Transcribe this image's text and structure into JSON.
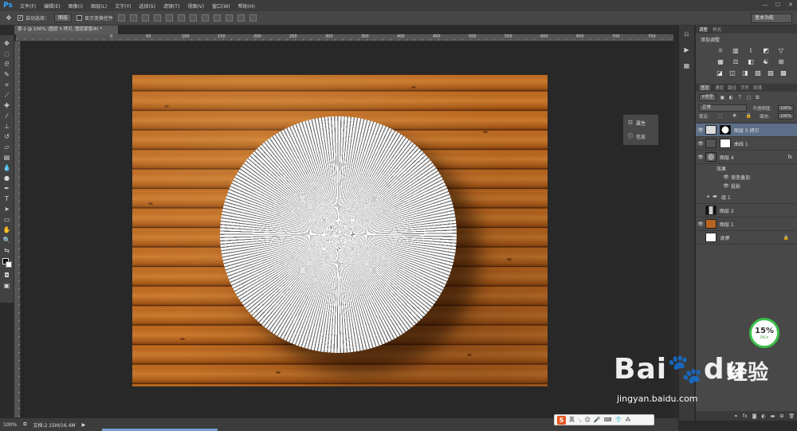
{
  "app": {
    "logo": "Ps",
    "menus": [
      "文件(F)",
      "编辑(E)",
      "图像(I)",
      "图层(L)",
      "文字(Y)",
      "选择(S)",
      "滤镜(T)",
      "视图(V)",
      "窗口(W)",
      "帮助(H)"
    ],
    "window_buttons": [
      "—",
      "☐",
      "✕"
    ]
  },
  "options": {
    "auto_select_label": "自动选择：",
    "auto_select_target": "图层",
    "show_transform_label": "显示变换控件",
    "workspace": "基本功能"
  },
  "document": {
    "tab_title": "景-1 @ 100% (图层 5 拷贝, 图层蒙版/8) *",
    "ruler_marks": [
      "0",
      "50",
      "100",
      "150",
      "200",
      "250",
      "300",
      "350",
      "400",
      "450",
      "500",
      "550",
      "600",
      "650",
      "700",
      "750",
      "800"
    ]
  },
  "float_panel": {
    "properties": "属性",
    "info": "信息"
  },
  "adjustments": {
    "tabs": [
      "调整",
      "样式"
    ],
    "title": "添加调整"
  },
  "layers_panel": {
    "tabs": [
      "图层",
      "通道",
      "路径",
      "字符",
      "段落"
    ],
    "filter": "P类型",
    "blend_mode": "正常",
    "opacity_label": "不透明度:",
    "opacity": "100%",
    "lock_label": "锁定:",
    "fill_label": "填充:",
    "fill": "100%",
    "layers": [
      {
        "name": "图层 5 拷贝",
        "selected": true
      },
      {
        "name": "曲线 1"
      },
      {
        "name": "图层 4",
        "fx": "fx"
      },
      {
        "name": "效果",
        "sub": true
      },
      {
        "name": "渐变叠加",
        "sub": true
      },
      {
        "name": "投影",
        "sub": true
      },
      {
        "name": "组 1"
      },
      {
        "name": "图层 2"
      },
      {
        "name": "图层 1"
      },
      {
        "name": "背景"
      }
    ]
  },
  "status": {
    "zoom": "100%",
    "doc_size": "文档:2.15M/16.4M"
  },
  "speed_gauge": {
    "percent": "15%",
    "speed": "0K/s"
  },
  "ime_bar": {
    "label": "英"
  },
  "watermark": {
    "logo": "Bai",
    "logo_tail": "du",
    "cn": "经验",
    "url": "jingyan.baidu.com"
  }
}
